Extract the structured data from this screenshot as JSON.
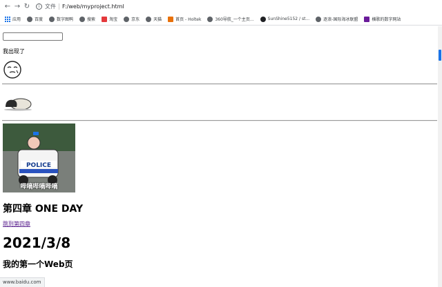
{
  "browser": {
    "file_label": "文件",
    "url": "F:/web/myproject.html",
    "bookmarks": [
      {
        "label": "应用",
        "color": "#1a73e8",
        "kind": "apps-icon"
      },
      {
        "label": "百度",
        "color": "#5f6368",
        "kind": "globe-icon"
      },
      {
        "label": "数字图鸭",
        "color": "#5f6368",
        "kind": "globe-icon"
      },
      {
        "label": "搜索",
        "color": "#5f6368",
        "kind": "globe-icon"
      },
      {
        "label": "淘宝",
        "color": "#e4393c",
        "kind": "taobao-icon"
      },
      {
        "label": "京东",
        "color": "#5f6368",
        "kind": "globe-icon"
      },
      {
        "label": "天猫",
        "color": "#5f6368",
        "kind": "globe-icon"
      },
      {
        "label": "首页 - Holtek",
        "color": "#e8710a",
        "kind": "holtek-icon"
      },
      {
        "label": "360导航_一个主页...",
        "color": "#5f6368",
        "kind": "globe-icon"
      },
      {
        "label": "SunShine5152 / st...",
        "color": "#202124",
        "kind": "github-icon"
      },
      {
        "label": "逐浪-国际海冰联盟",
        "color": "#5f6368",
        "kind": "globe-icon"
      },
      {
        "label": "横歌的数字网站",
        "color": "#6a1b9a",
        "kind": "w-icon"
      }
    ]
  },
  "page": {
    "appeared_text": "我出现了",
    "police_caption": "哔嘀哔嘀哔嘀",
    "chapter_title": "第四章 ONE DAY",
    "chapter_link": "跳到第四章",
    "date_heading": "2021/3/8",
    "first_web": "我的第一个Web页"
  },
  "status": {
    "url": "www.baidu.com"
  }
}
